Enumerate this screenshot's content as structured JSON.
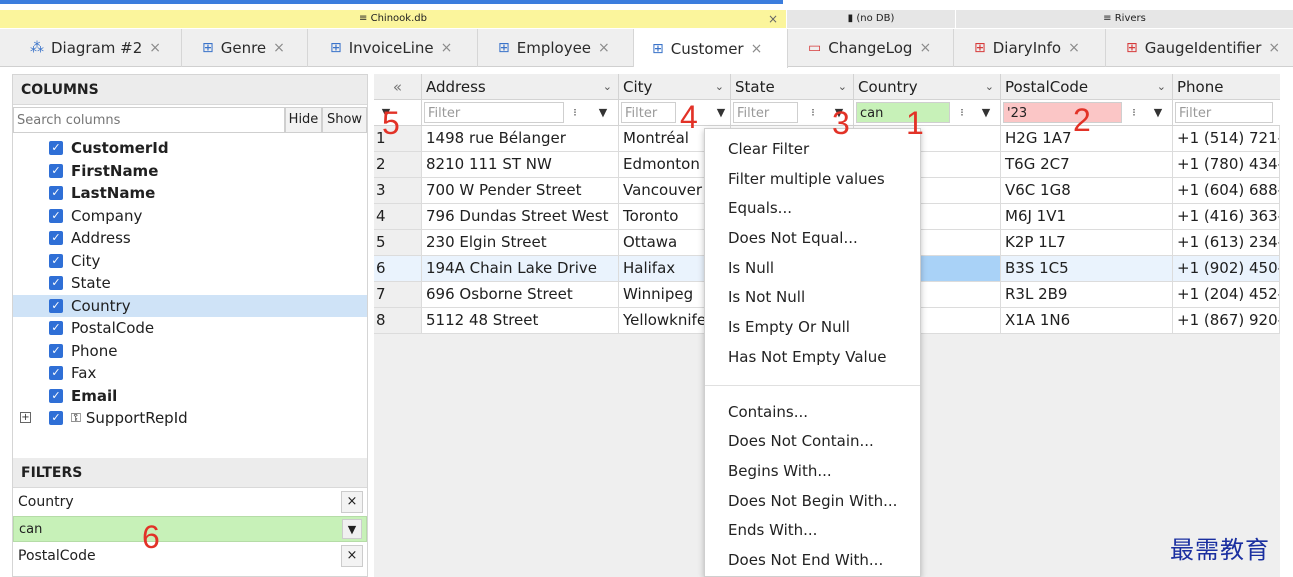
{
  "db_groups": [
    {
      "icon": "≡",
      "label": "Chinook.db",
      "close": "×"
    },
    {
      "icon": "▮",
      "label": "(no DB)"
    },
    {
      "icon": "≡",
      "label": "Rivers"
    }
  ],
  "tabs": [
    {
      "label": "Diagram #2",
      "icon": "diagram-icon"
    },
    {
      "label": "Genre",
      "icon": "table-icon"
    },
    {
      "label": "InvoiceLine",
      "icon": "table-icon"
    },
    {
      "label": "Employee",
      "icon": "table-icon"
    },
    {
      "label": "Customer",
      "icon": "table-icon",
      "active": true
    },
    {
      "label": "ChangeLog",
      "icon": "view-icon"
    },
    {
      "label": "DiaryInfo",
      "icon": "table-icon-red"
    },
    {
      "label": "GaugeIdentifier",
      "icon": "table-icon-red"
    }
  ],
  "columns_panel": {
    "title": "COLUMNS",
    "search_placeholder": "Search columns",
    "hide_label": "Hide",
    "show_label": "Show",
    "items": [
      {
        "label": "CustomerId",
        "bold": true
      },
      {
        "label": "FirstName",
        "bold": true
      },
      {
        "label": "LastName",
        "bold": true
      },
      {
        "label": "Company"
      },
      {
        "label": "Address"
      },
      {
        "label": "City"
      },
      {
        "label": "State"
      },
      {
        "label": "Country",
        "selected": true
      },
      {
        "label": "PostalCode"
      },
      {
        "label": "Phone"
      },
      {
        "label": "Fax"
      },
      {
        "label": "Email",
        "bold": true
      },
      {
        "label": "SupportRepId",
        "fk": true
      }
    ]
  },
  "filters_panel": {
    "title": "FILTERS",
    "filters": [
      {
        "column": "Country",
        "value": "can"
      },
      {
        "column": "PostalCode",
        "value": ""
      }
    ]
  },
  "grid": {
    "collapse_label": "«",
    "headers": [
      "Address",
      "City",
      "State",
      "Country",
      "PostalCode",
      "Phone"
    ],
    "filter_placeholder": "Filter",
    "country_filter": "can",
    "postal_filter": "'23",
    "rows": [
      {
        "n": "1",
        "address": "1498 rue Bélanger",
        "city": "Montréal",
        "postal": "H2G 1A7",
        "phone": "+1 (514) 721-"
      },
      {
        "n": "2",
        "address": "8210 111 ST NW",
        "city": "Edmonton",
        "postal": "T6G 2C7",
        "phone": "+1 (780) 434-"
      },
      {
        "n": "3",
        "address": "700 W Pender Street",
        "city": "Vancouver",
        "postal": "V6C 1G8",
        "phone": "+1 (604) 688-"
      },
      {
        "n": "4",
        "address": "796 Dundas Street West",
        "city": "Toronto",
        "postal": "M6J 1V1",
        "phone": "+1 (416) 363-"
      },
      {
        "n": "5",
        "address": "230 Elgin Street",
        "city": "Ottawa",
        "postal": "K2P 1L7",
        "phone": "+1 (613) 234-"
      },
      {
        "n": "6",
        "address": "194A Chain Lake Drive",
        "city": "Halifax",
        "postal": "B3S 1C5",
        "phone": "+1 (902) 450-"
      },
      {
        "n": "7",
        "address": "696 Osborne Street",
        "city": "Winnipeg",
        "postal": "R3L 2B9",
        "phone": "+1 (204) 452-"
      },
      {
        "n": "8",
        "address": "5112 48 Street",
        "city": "Yellowknife",
        "postal": "X1A 1N6",
        "phone": "+1 (867) 920-"
      }
    ]
  },
  "filter_menu": {
    "items_top": [
      "Clear Filter",
      "Filter multiple values",
      "Equals...",
      "Does Not Equal...",
      "Is Null",
      "Is Not Null",
      "Is Empty Or Null",
      "Has Not Empty Value"
    ],
    "items_bottom": [
      "Contains...",
      "Does Not Contain...",
      "Begins With...",
      "Does Not Begin With...",
      "Ends With...",
      "Does Not End With..."
    ]
  },
  "annotations": [
    "1",
    "2",
    "3",
    "4",
    "5",
    "6"
  ],
  "watermark": "最需教育"
}
